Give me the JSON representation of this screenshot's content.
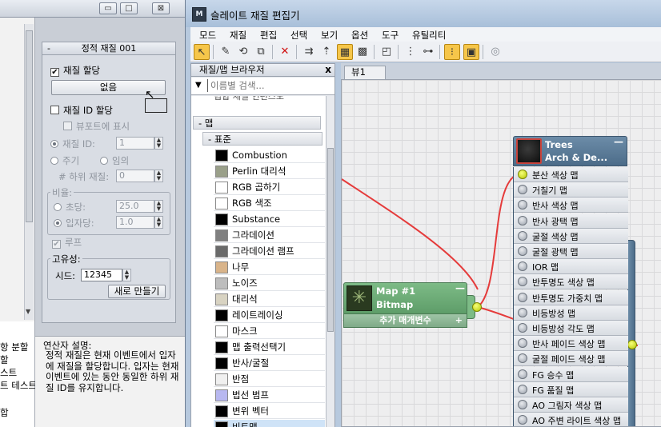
{
  "left_panel": {
    "top_buttons": [
      "▭",
      "□",
      "⊠"
    ],
    "rollout": {
      "title": "정적 재질 001",
      "minus": "-",
      "material_assign_label": "재질 할당",
      "none_button": "없음",
      "material_id_assign_label": "재질 ID 할당",
      "show_in_viewport_label": "뷰포트에 표시",
      "material_id_label": "재질 ID:",
      "material_id_value": "1",
      "period_label": "주기",
      "random_label": "임의",
      "sub_material_label": "# 하위 재질:",
      "sub_material_value": "0",
      "ratio_label": "비율:",
      "seconds_label": "초당:",
      "seconds_value": "25.0",
      "per_particle_label": "입자당:",
      "per_particle_value": "1.0",
      "loop_label": "루프",
      "uniqueness_label": "고유성:",
      "seed_label": "시드:",
      "seed_value": "12345",
      "new_button": "새로 만들기"
    },
    "operator_description_title": "연산자 설명:",
    "operator_description": "정적 재질은 현재 이벤트에서 입자에 재질을 할당합니다. 입자는 현재 이벤트에 있는 동안 동일한 하위 재질 ID를 유지합니다.",
    "left_list": [
      "항 분할",
      "할",
      "스트",
      "트 테스트",
      "합"
    ]
  },
  "window": {
    "title": "슬레이트 재질 편집기",
    "icon_text": "M"
  },
  "menu": [
    "모드",
    "재질",
    "편집",
    "선택",
    "보기",
    "옵션",
    "도구",
    "유틸리티"
  ],
  "toolbar_icons": [
    "select-arrow-icon",
    "eyedropper-icon",
    "put-material-icon",
    "assign-material-icon",
    "delete-icon",
    "move-children-icon",
    "hide-unused-slots-icon",
    "background-icon",
    "checker-icon",
    "show-map-icon",
    "layout-vertical-icon",
    "layout-children-icon",
    "material-map-navigator-icon",
    "parameter-editor-icon",
    "select-by-material-icon"
  ],
  "browser": {
    "title": "재질/맵 브라우저",
    "close": "x",
    "search_placeholder": "이름별 검색...",
    "partial_item": "립합 재질 인편스모",
    "maps_group": "- 맵",
    "standard_group": "- 표준",
    "items": [
      {
        "label": "Combustion",
        "swatch": "#000000"
      },
      {
        "label": "Perlin 대리석",
        "swatch": "#9aa08a"
      },
      {
        "label": "RGB 곱하기",
        "swatch": "#ffffff"
      },
      {
        "label": "RGB 색조",
        "swatch": "#ffffff"
      },
      {
        "label": "Substance",
        "swatch": "#000000"
      },
      {
        "label": "그라데이션",
        "swatch": "#808080"
      },
      {
        "label": "그라데이션 램프",
        "swatch": "#6a6a6a"
      },
      {
        "label": "나무",
        "swatch": "#d9b48a"
      },
      {
        "label": "노이즈",
        "swatch": "#bdbdbd"
      },
      {
        "label": "대리석",
        "swatch": "#d8d3c2"
      },
      {
        "label": "레이트레이싱",
        "swatch": "#000000"
      },
      {
        "label": "마스크",
        "swatch": "#ffffff"
      },
      {
        "label": "맵 출력선택기",
        "swatch": "#000000"
      },
      {
        "label": "반사/굴절",
        "swatch": "#000000"
      },
      {
        "label": "반점",
        "swatch": "#f0f0f0"
      },
      {
        "label": "법선 범프",
        "swatch": "#b8b8f0"
      },
      {
        "label": "변위 벡터",
        "swatch": "#000000"
      },
      {
        "label": "비트맵",
        "swatch": "#000000"
      }
    ]
  },
  "view_tab": "뷰1",
  "nodes": {
    "bitmap": {
      "title": "Map #1",
      "subtitle": "Bitmap",
      "minus": "—",
      "footer": "추가 매개변수",
      "footer_plus": "+"
    },
    "material": {
      "title": "Trees",
      "subtitle": "Arch & De...",
      "minus": "—",
      "slots": [
        "분산 색상 맵",
        "거칠기 맵",
        "반사 색상 맵",
        "반사 광택 맵",
        "굴절 색상 맵",
        "굴절 광택 맵",
        "IOR 맵",
        "반투명도 색상 맵",
        "반투명도 가중치 맵",
        "비등방성 맵",
        "비등방성 각도 맵",
        "반사 페이드 색상 맵",
        "굴절 페이드 색상 맵",
        "FG 승수 맵",
        "FG 품질 맵",
        "AO 그림자 색상 맵",
        "AO 주변 라이트 색상 맵"
      ]
    }
  },
  "colors": {
    "wire": "#e53b3b",
    "port_lit": "#d6e600",
    "green_node": "#6aa874",
    "blue_node": "#5b7b98"
  }
}
